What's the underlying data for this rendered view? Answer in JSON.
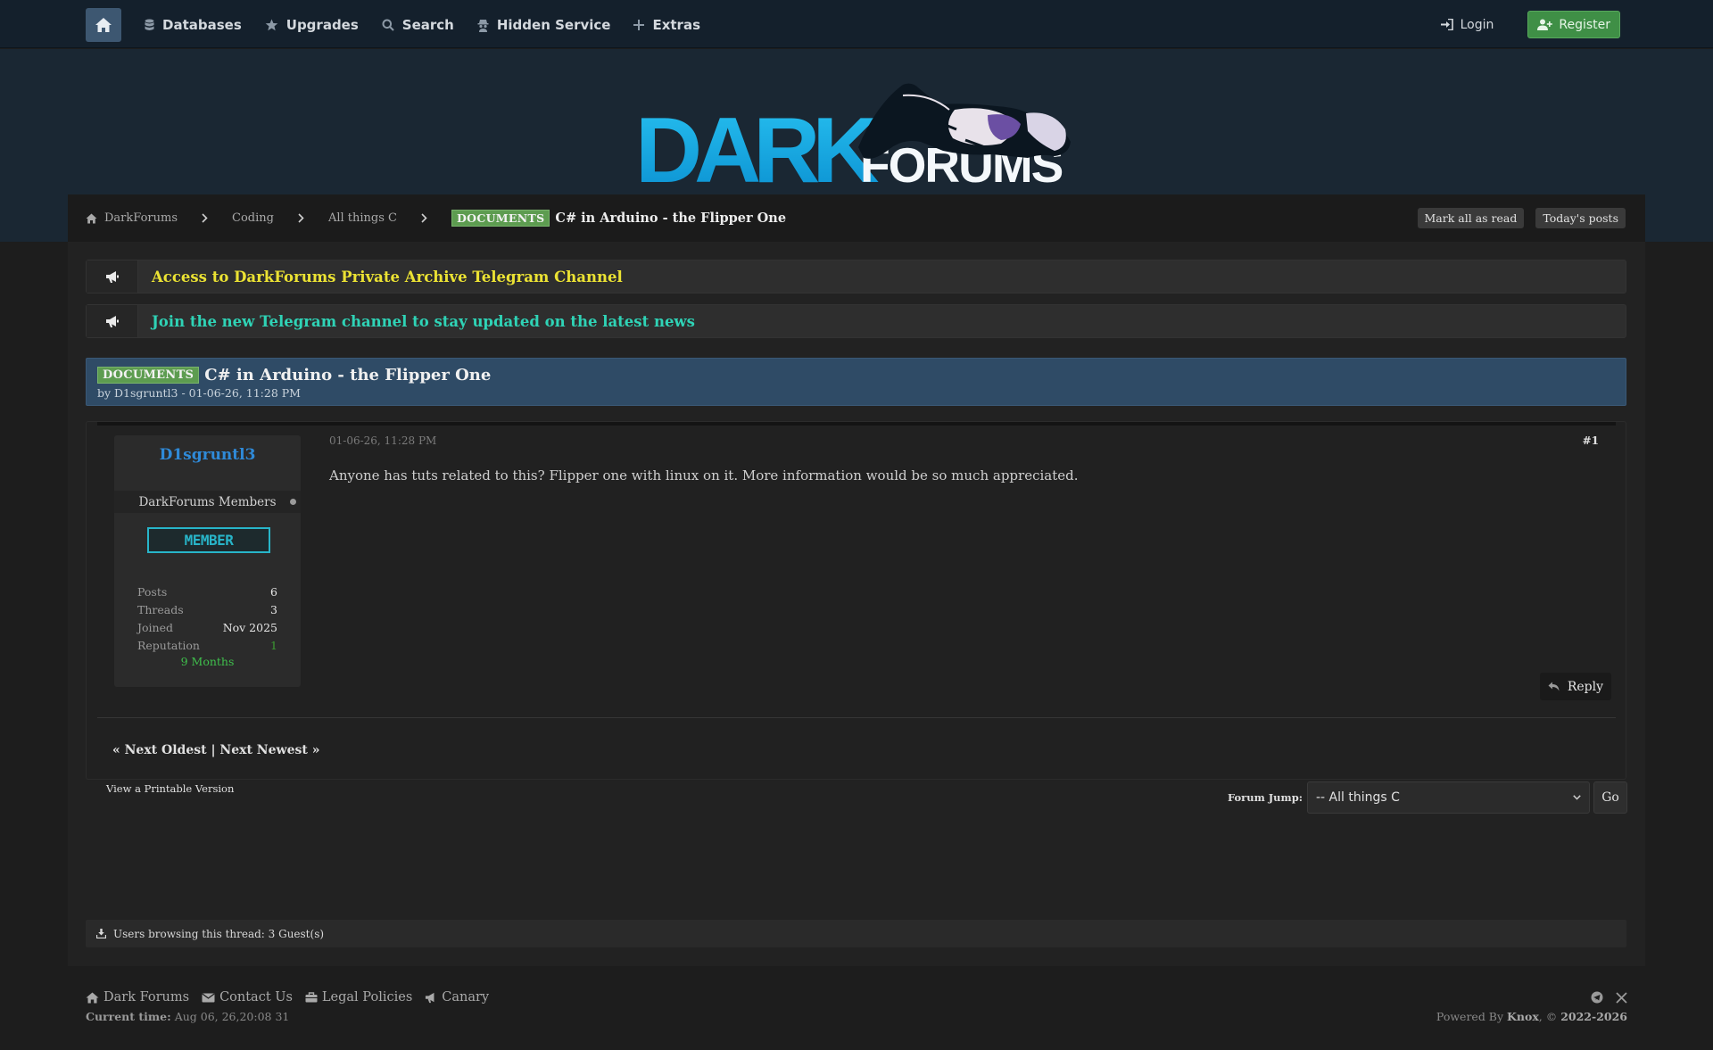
{
  "nav": {
    "items": [
      {
        "label": "Databases",
        "icon": "database-icon"
      },
      {
        "label": "Upgrades",
        "icon": "star-icon"
      },
      {
        "label": "Search",
        "icon": "search-icon"
      },
      {
        "label": "Hidden Service",
        "icon": "spy-icon"
      },
      {
        "label": "Extras",
        "icon": "plus-icon"
      }
    ],
    "login": "Login",
    "register": "Register"
  },
  "logo": {
    "text_main": "DARK",
    "text_sub": "FORUMS"
  },
  "breadcrumb": {
    "items": [
      "DarkForums",
      "Coding",
      "All things C"
    ],
    "prefix": "DOCUMENTS",
    "current": "C# in Arduino - the Flipper One"
  },
  "actions": {
    "mark_read": "Mark all as read",
    "todays_posts": "Today's posts"
  },
  "announcements": [
    {
      "text": "Access to DarkForums Private Archive Telegram Channel",
      "color": "#ebe233"
    },
    {
      "text": "Join the new Telegram channel to stay updated on the latest news",
      "color": "#2fd3b6"
    }
  ],
  "thread": {
    "prefix": "DOCUMENTS",
    "title": "C# in Arduino - the Flipper One",
    "meta": "by D1sgruntl3 - 01-06-26, 11:28 PM"
  },
  "post": {
    "username": "D1sgruntl3",
    "group": "DarkForums Members",
    "rank_badge": "MEMBER",
    "stats": [
      {
        "k": "Posts",
        "v": "6"
      },
      {
        "k": "Threads",
        "v": "3"
      },
      {
        "k": "Joined",
        "v": "Nov 2025"
      },
      {
        "k": "Reputation",
        "v": "1"
      }
    ],
    "membership": "9 Months",
    "date": "01-06-26, 11:28 PM",
    "number": "#1",
    "body": "Anyone has tuts related to this? Flipper one with linux on it. More information would be so much appreciated.",
    "reply": "Reply"
  },
  "pager": {
    "text": "« Next Oldest | Next Newest »"
  },
  "printable": "View a Printable Version",
  "forum_jump": {
    "label": "Forum Jump:",
    "selected": "-- All things C",
    "go": "Go"
  },
  "browsing": "Users browsing this thread: 3 Guest(s)",
  "footer": {
    "links": [
      "Dark Forums",
      "Contact Us",
      "Legal Policies",
      "Canary"
    ],
    "current_time_label": "Current time:",
    "current_time": "Aug 06, 26,20:08 31",
    "powered_prefix": "Powered By",
    "powered_name": "Knox",
    "powered_suffix": ", ©",
    "powered_years": "2022-2026"
  },
  "colors": {
    "accent": "#3d5771",
    "register": "#3f8f46",
    "username": "#2f8ad8",
    "rank": "#28b5c9"
  }
}
